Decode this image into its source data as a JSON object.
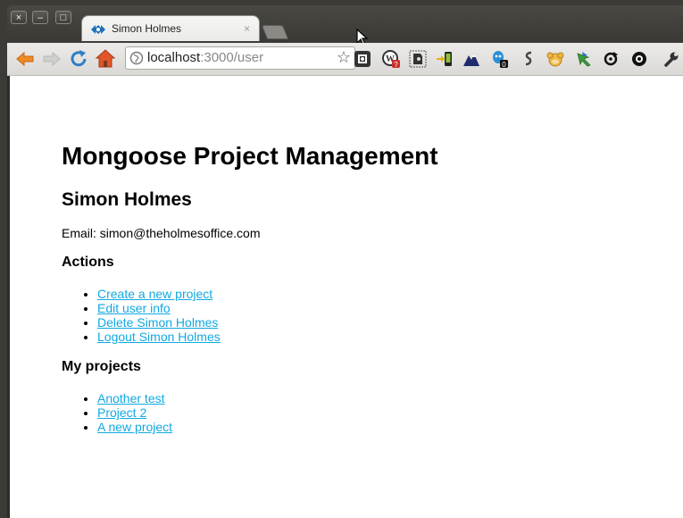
{
  "window": {
    "close_glyph": "×",
    "minimize_glyph": "–",
    "maximize_glyph": "□"
  },
  "tab": {
    "title": "Simon Holmes",
    "close_glyph": "×"
  },
  "address_bar": {
    "host": "localhost",
    "rest": ":3000/user",
    "bookmark_glyph": "☆"
  },
  "extension_badges": {
    "wordpress": "?",
    "counter": "0"
  },
  "page": {
    "site_title": "Mongoose Project Management",
    "user_name": "Simon Holmes",
    "email_label": "Email: simon@theholmesoffice.com",
    "actions_heading": "Actions",
    "actions": [
      {
        "label": "Create a new project"
      },
      {
        "label": "Edit user info"
      },
      {
        "label": "Delete Simon Holmes"
      },
      {
        "label": "Logout Simon Holmes"
      }
    ],
    "projects_heading": "My projects",
    "projects": [
      {
        "label": "Another test"
      },
      {
        "label": "Project 2"
      },
      {
        "label": "A new project"
      }
    ]
  },
  "colors": {
    "link": "#11a9e2",
    "chrome_dark": "#3c3b37",
    "toolbar": "#ecebe9"
  }
}
